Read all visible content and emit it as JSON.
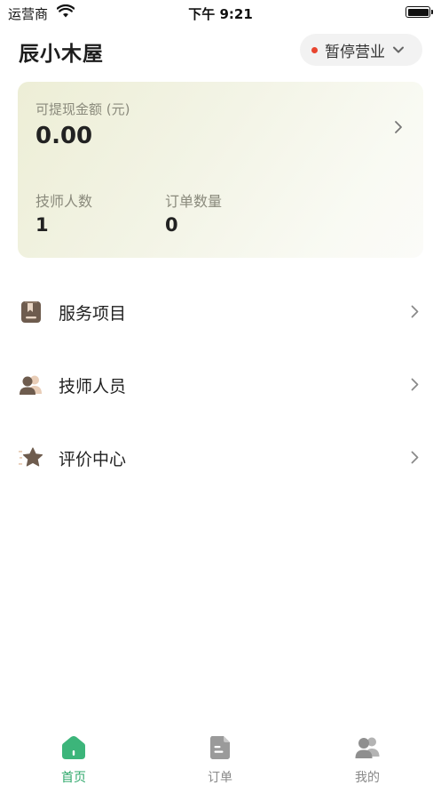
{
  "status_bar": {
    "carrier": "运营商",
    "time": "下午 9:21"
  },
  "header": {
    "shop_name": "辰小木屋",
    "status_label": "暂停营业",
    "status_color": "#e8452f"
  },
  "summary": {
    "withdrawable_label": "可提现金额 (元)",
    "withdrawable_value": "0.00",
    "stats": [
      {
        "label": "技师人数",
        "value": "1"
      },
      {
        "label": "订单数量",
        "value": "0"
      }
    ]
  },
  "menu": [
    {
      "label": "服务项目",
      "icon": "service-book-icon"
    },
    {
      "label": "技师人员",
      "icon": "technicians-icon"
    },
    {
      "label": "评价中心",
      "icon": "star-icon"
    }
  ],
  "tab_bar": {
    "active_color": "#2fa86b",
    "tabs": [
      {
        "label": "首页",
        "icon": "home-icon"
      },
      {
        "label": "订单",
        "icon": "order-icon"
      },
      {
        "label": "我的",
        "icon": "profile-icon"
      }
    ]
  }
}
